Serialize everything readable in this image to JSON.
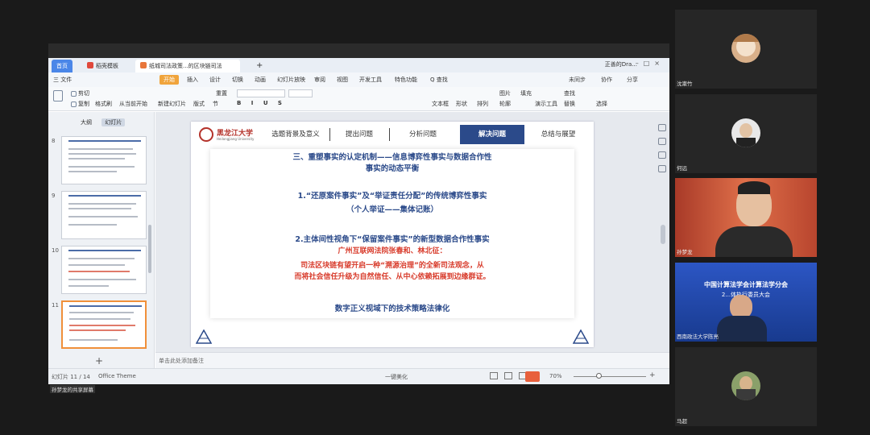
{
  "app": {
    "tabs": [
      "首页",
      "稻壳模板",
      "纸城司法政策...的区块链司法"
    ],
    "window_user": "正善的Dra...",
    "menu": [
      "三 文件",
      "开始",
      "插入",
      "设计",
      "切换",
      "动画",
      "幻灯片放映",
      "审阅",
      "视图",
      "开发工具",
      "特色功能",
      "Q 查找"
    ],
    "menu_right": [
      "未同步",
      "协作",
      "分享"
    ],
    "toolbar": [
      "剪切",
      "复制",
      "格式刷",
      "从当前开始",
      "新建幻灯片",
      "版式",
      "节",
      "重置",
      "文本框",
      "形状",
      "排列",
      "轮廓",
      "图片",
      "填充",
      "演示工具",
      "替换",
      "选择",
      "查找"
    ]
  },
  "left_pane": {
    "tabs": [
      "大纲",
      "幻灯片"
    ],
    "thumb_numbers": [
      "8",
      "9",
      "10",
      "11"
    ]
  },
  "slide": {
    "logo_cn": "黑龙江大学",
    "logo_en": "Heilongjiang University",
    "nav": [
      "选题背景及意义",
      "提出问题",
      "分析问题",
      "解决问题",
      "总结与展望"
    ],
    "active_nav": "解决问题",
    "line1": "三、重塑事实的认定机制——信息博弈性事实与数据合作性",
    "line2": "事实的动态平衡",
    "line3": "1.“还原案件事实”及“举证责任分配”的传统博弈性事实",
    "line4": "（个人举证——集体记账）",
    "line5": "2.主体间性视角下“保留案件事实”的新型数据合作性事实",
    "line6": "广州互联网法院张春和、林北征：",
    "line7": "司法区块链有望开启一种“溯源治理”的全新司法观念，从",
    "line8": "而将社会信任升级为自然信任、从中心依赖拓展到边缘群证。",
    "line9": "数字正义视域下的技术策略法律化",
    "colors": {
      "blue": "#2b4a8a",
      "red": "#d83b2b"
    }
  },
  "notes_placeholder": "单击此处添加备注",
  "status": {
    "slide_index": "幻灯片 11 / 14",
    "theme": "Office Theme",
    "beautify": "一键美化",
    "zoom": "70%"
  },
  "share_label": "孙梦龙的共享屏幕",
  "participants": [
    {
      "name": "沈漱竹"
    },
    {
      "name": "何远"
    },
    {
      "name": "孙梦龙"
    },
    {
      "name": "西南政法大学陈亮",
      "banner_line1": "中国计算法学会计算法学分会",
      "banner_line2": "2...体执行委员大会"
    },
    {
      "name": "马超"
    }
  ]
}
